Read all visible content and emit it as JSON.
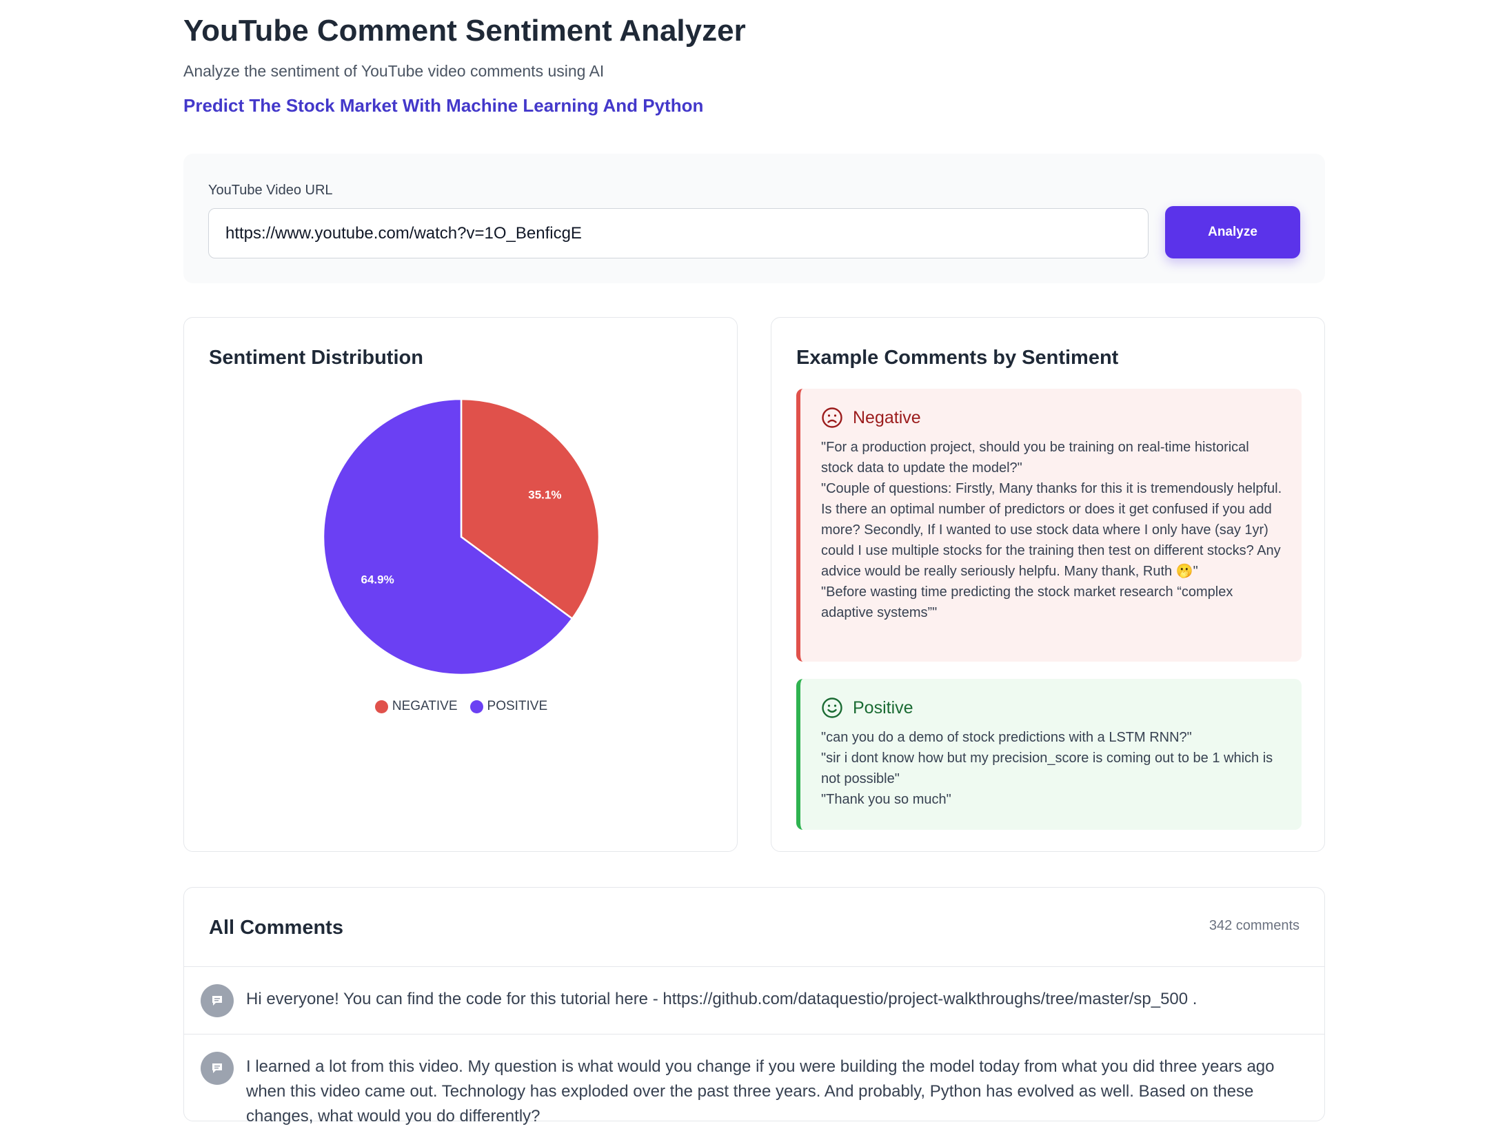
{
  "header": {
    "title": "YouTube Comment Sentiment Analyzer",
    "subtitle": "Analyze the sentiment of YouTube video comments using AI",
    "video_title": "Predict The Stock Market With Machine Learning And Python"
  },
  "url_form": {
    "label": "YouTube Video URL",
    "value": "https://www.youtube.com/watch?v=1O_BenficgE",
    "button_label": "Analyze"
  },
  "distribution": {
    "title": "Sentiment Distribution",
    "colors": {
      "negative": "#e0514b",
      "positive": "#6b40f3"
    }
  },
  "chart_data": {
    "type": "pie",
    "labels": [
      "NEGATIVE",
      "POSITIVE"
    ],
    "values": [
      35.1,
      64.9
    ],
    "data_labels": [
      "35.1%",
      "64.9%"
    ],
    "colors": [
      "#e0514b",
      "#6b40f3"
    ],
    "legend_position": "bottom"
  },
  "examples": {
    "title": "Example Comments by Sentiment",
    "negative": {
      "label": "Negative",
      "icon": "frown-face-icon",
      "color": "#9b1c1c",
      "comments": [
        "\"For a production project, should you be training on real-time historical stock data to update the model?\"",
        "\"Couple of questions: Firstly, Many thanks for this it is tremendously helpful. Is there an optimal number of predictors or does it get confused if you add more? Secondly, If I wanted to use stock data where I only have (say 1yr) could I use multiple stocks for the training then test on different stocks? Any advice would be really seriously helpfu. Many thank, Ruth 🫢\"",
        "\"Before wasting time predicting the stock market research “complex adaptive systems”\""
      ]
    },
    "positive": {
      "label": "Positive",
      "icon": "smile-face-icon",
      "color": "#1a6b33",
      "comments": [
        "\"can you do a demo of stock predictions with a LSTM RNN?\"",
        "\"sir i dont know how but my precision_score is coming out to be 1 which is not possible\"",
        "\"Thank you so much\""
      ]
    }
  },
  "all_comments": {
    "title": "All Comments",
    "count": "342 comments",
    "items": [
      {
        "text": "Hi everyone! You can find the code for this tutorial here - https://github.com/dataquestio/project-walkthroughs/tree/master/sp_500 ."
      },
      {
        "text": "I learned a lot from this video. My question is what would you change if you were building the model today from what you did three years ago when this video came out. Technology has exploded over the past three years. And probably, Python has evolved as well. Based on these changes, what would you do differently?"
      }
    ]
  }
}
